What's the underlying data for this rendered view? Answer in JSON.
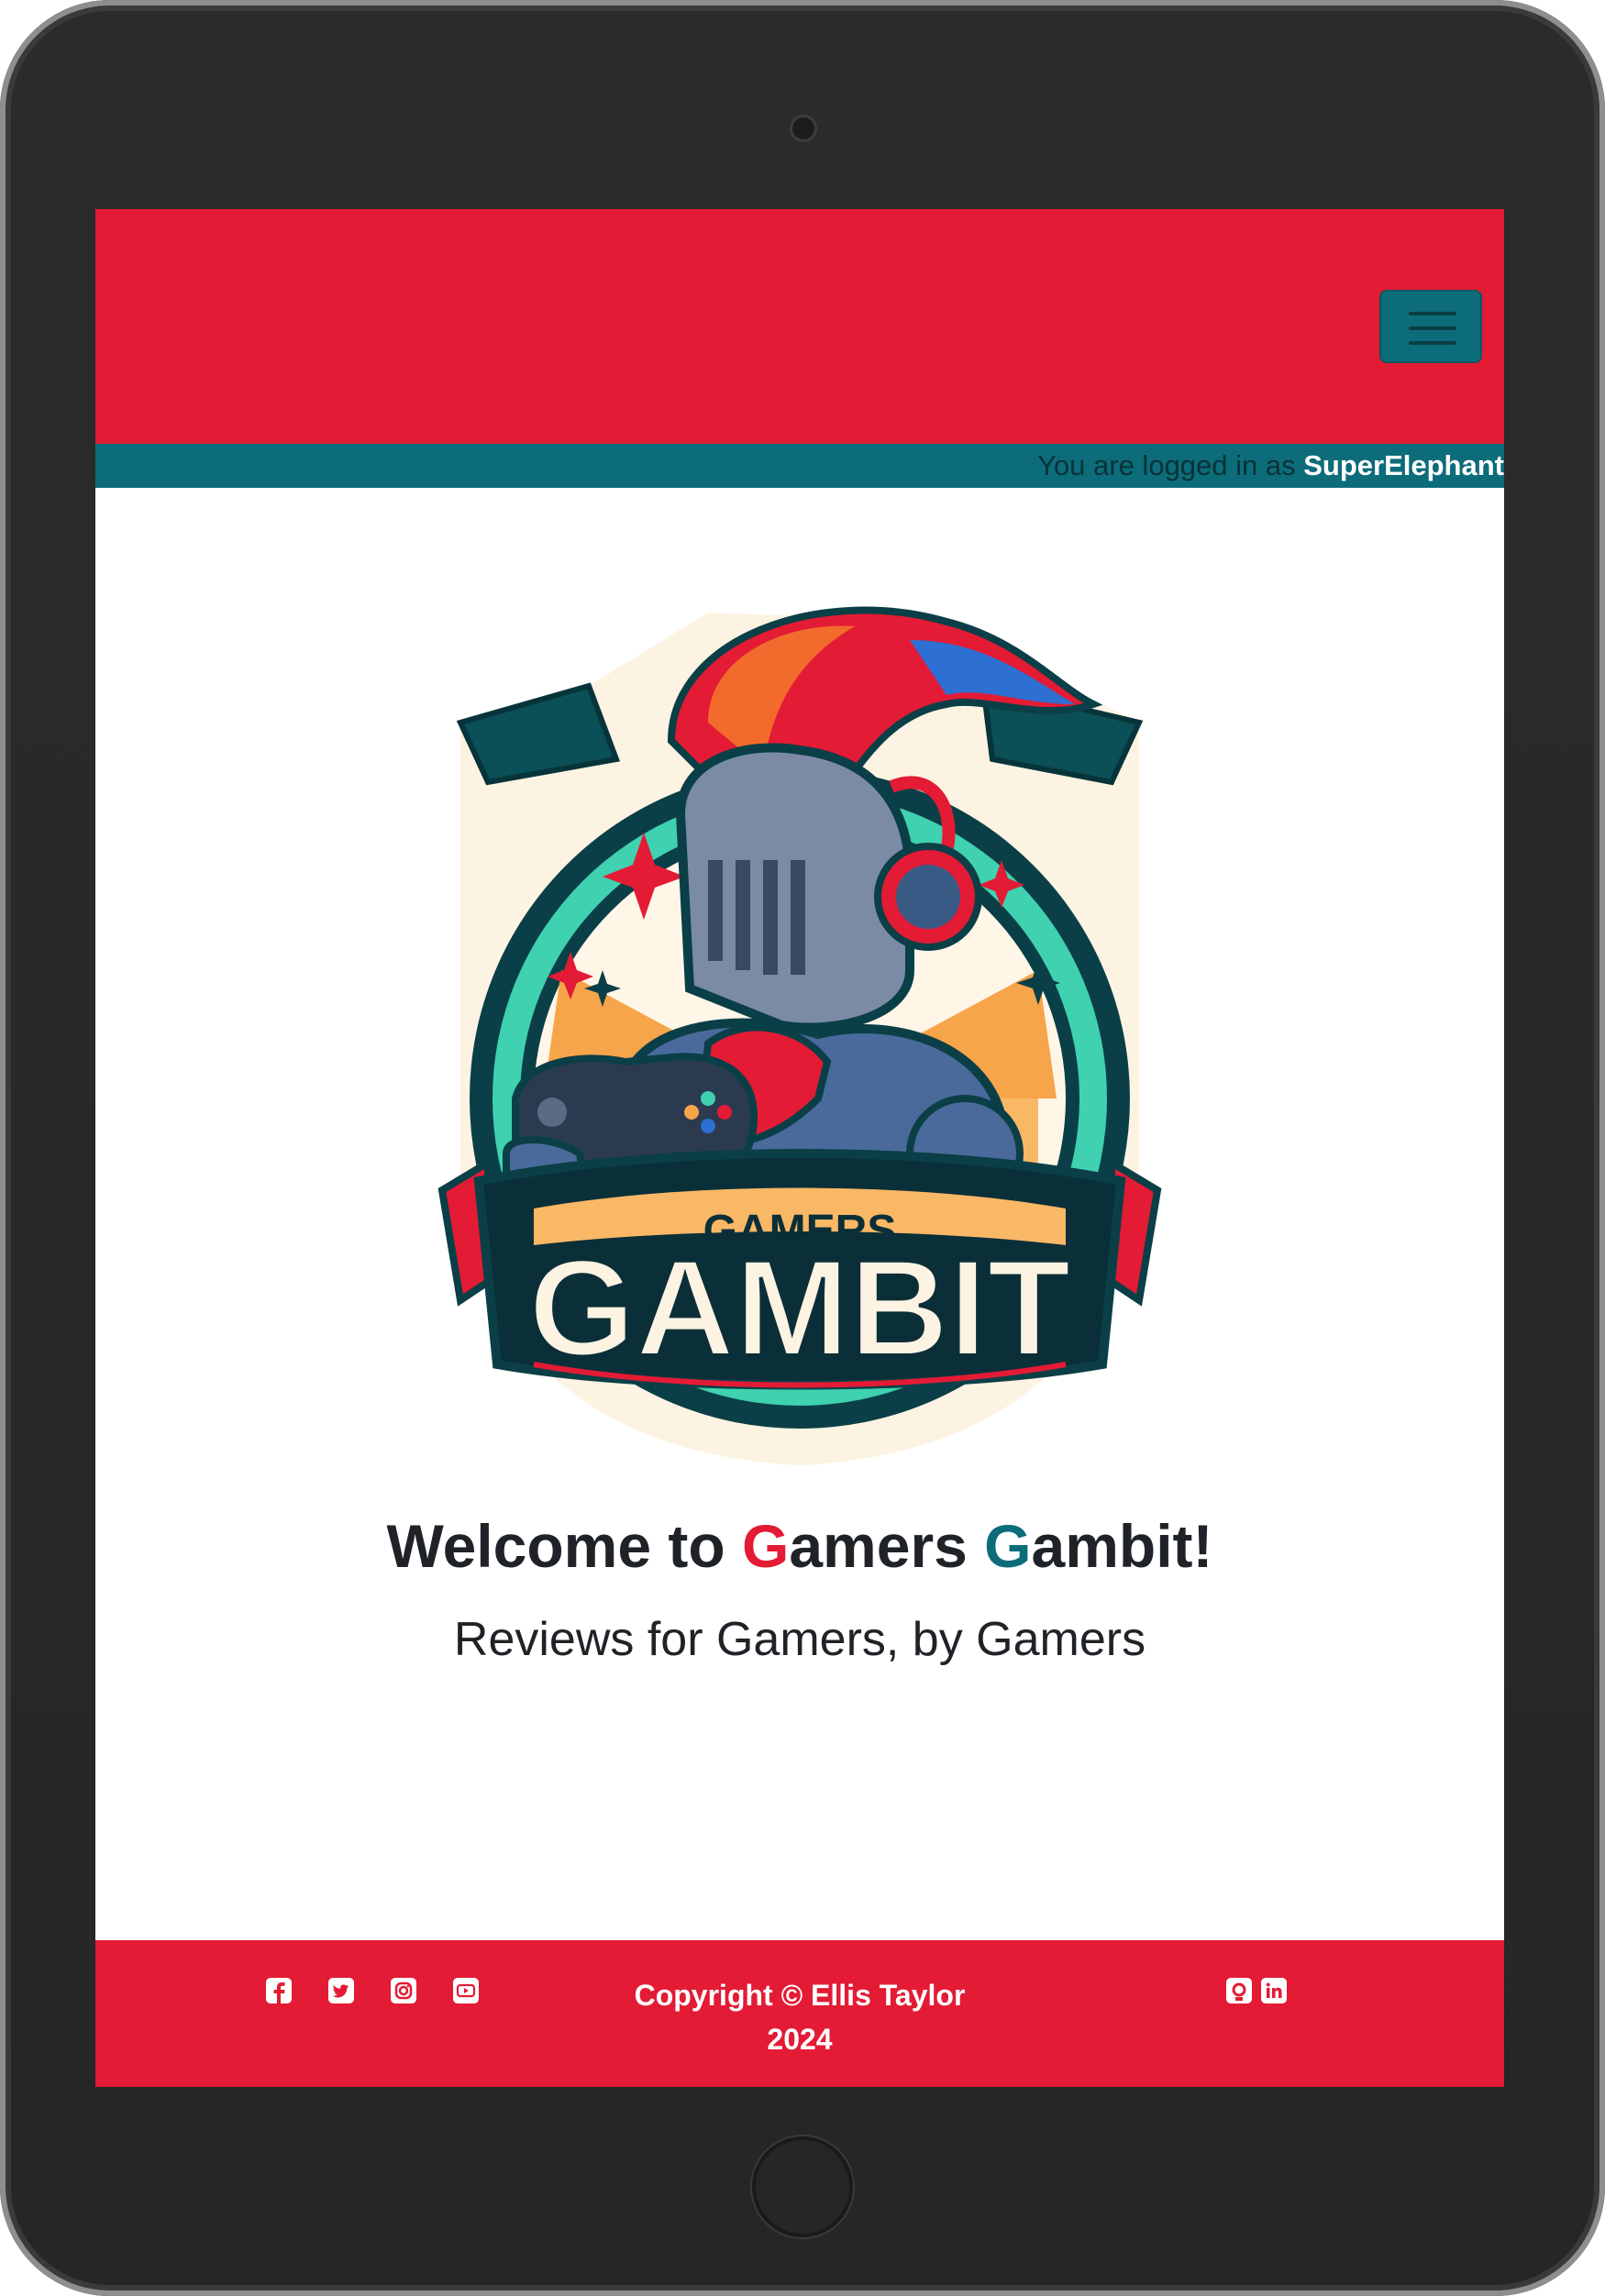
{
  "header": {
    "menu_toggle_icon": "hamburger-menu-icon",
    "brand_color": "#e31b35",
    "accent_color": "#0d6c79"
  },
  "login_status": {
    "prefix": "You are logged in as ",
    "username": "SuperElephant"
  },
  "logo": {
    "top_text": "GAMERS",
    "main_text": "GAMBIT"
  },
  "hero": {
    "welcome_pre": "Welcome to ",
    "g1": "G",
    "word1_rest": "amers ",
    "g2": "G",
    "word2_rest": "ambit!",
    "tagline": "Reviews for Gamers, by Gamers"
  },
  "footer": {
    "copyright_line1": "Copyright © Ellis Taylor",
    "copyright_line2": "2024",
    "social_left": [
      "facebook-icon",
      "twitter-icon",
      "instagram-icon",
      "youtube-icon"
    ],
    "social_right": [
      "github-icon",
      "linkedin-icon"
    ]
  }
}
